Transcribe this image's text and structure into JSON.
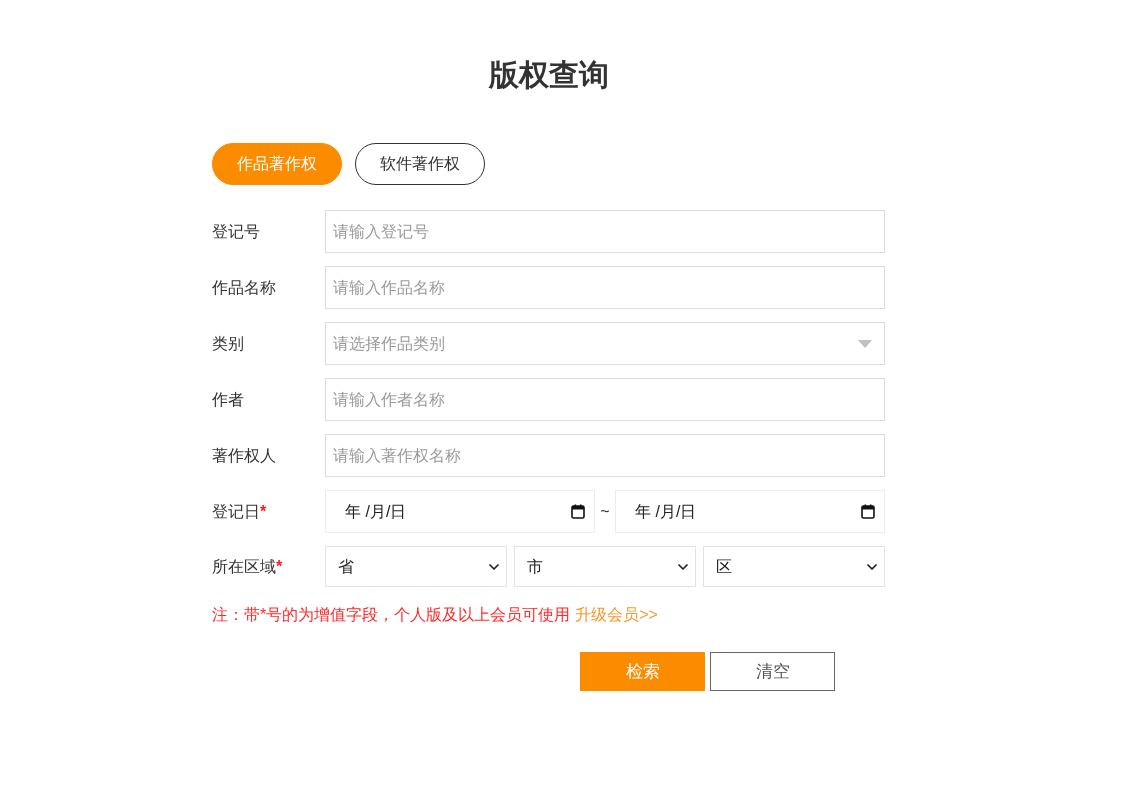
{
  "title": "版权查询",
  "tabs": [
    {
      "label": "作品著作权",
      "selected": true
    },
    {
      "label": "软件著作权",
      "selected": false
    }
  ],
  "required_mark": "*",
  "fields": [
    {
      "kind": "text",
      "label": "登记号",
      "required": false,
      "placeholder": "请输入登记号"
    },
    {
      "kind": "text",
      "label": "作品名称",
      "required": false,
      "placeholder": "请输入作品名称"
    },
    {
      "kind": "dropdown",
      "label": "类别",
      "required": false,
      "placeholder": "请选择作品类别"
    },
    {
      "kind": "text",
      "label": "作者",
      "required": false,
      "placeholder": "请输入作者名称"
    },
    {
      "kind": "text",
      "label": "著作权人",
      "required": false,
      "placeholder": "请输入著作权名称"
    },
    {
      "kind": "date_range",
      "label": "登记日",
      "required": true,
      "separator": "~",
      "inputs": [
        {
          "value": "年 /月/日"
        },
        {
          "value": "年 /月/日"
        }
      ]
    },
    {
      "kind": "selects",
      "label": "所在区域",
      "required": true,
      "selects": [
        {
          "value": "省"
        },
        {
          "value": "市"
        },
        {
          "value": "区"
        }
      ]
    }
  ],
  "note": {
    "text": "注：带*号的为增值字段，个人版及以上会员可使用",
    "link": "升级会员>>"
  },
  "buttons": [
    {
      "label": "检索",
      "kind": "primary"
    },
    {
      "label": "清空",
      "kind": "secondary"
    }
  ]
}
